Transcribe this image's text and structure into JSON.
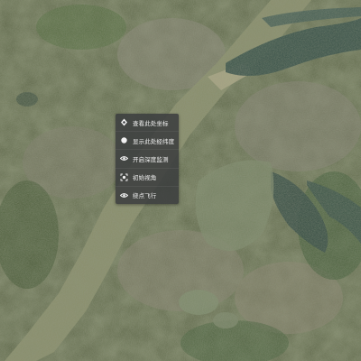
{
  "context_menu": {
    "items": [
      {
        "label": "查看此处坐标",
        "icon": "diamond-pin-icon"
      },
      {
        "label": "显示此处经纬度",
        "icon": "dot-icon"
      },
      {
        "label": "开启深度监测",
        "icon": "eye-icon"
      },
      {
        "label": "初始视角",
        "icon": "camera-view-icon"
      },
      {
        "label": "绕点飞行",
        "icon": "eye-icon"
      }
    ]
  },
  "colors": {
    "menu_bg": "#3a3c3e",
    "menu_text": "#f2f2f2",
    "river": "#8c916c",
    "lake": "#2f4a44"
  }
}
